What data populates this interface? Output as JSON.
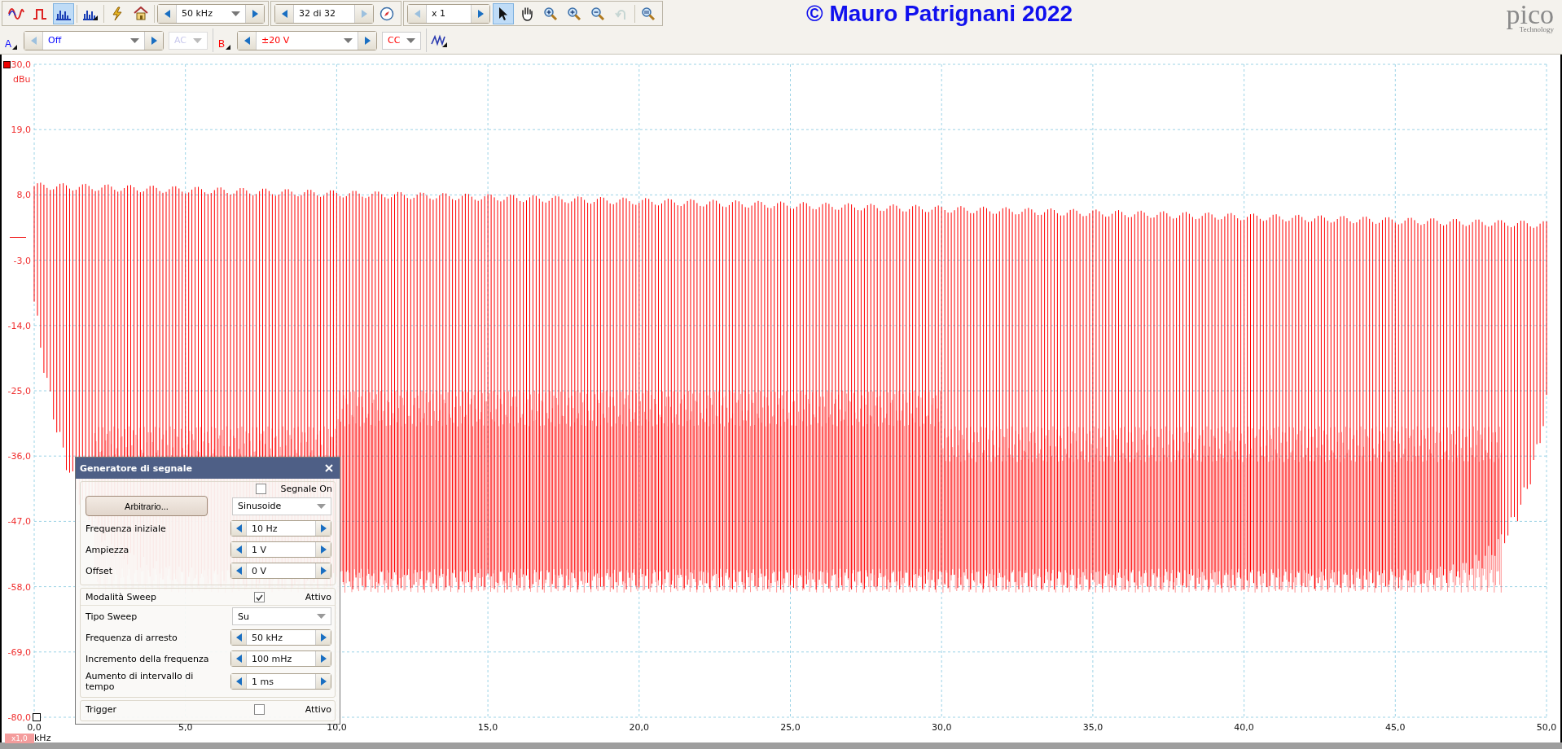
{
  "toolbar": {
    "modes": [
      {
        "kind": "scope",
        "selected": false
      },
      {
        "kind": "persistence",
        "selected": false
      },
      {
        "kind": "spectrum",
        "selected": true
      }
    ],
    "actions": [
      {
        "kind": "spectrum-options"
      },
      {
        "kind": "generator"
      },
      {
        "kind": "home"
      }
    ],
    "timebase": {
      "value": "50 kHz"
    },
    "capture": {
      "value": "32 di 32",
      "next_disabled": true
    },
    "zoom": {
      "value": "x 1",
      "prev_disabled": true
    },
    "tools": [
      {
        "kind": "pointer",
        "selected": true,
        "disabled": false
      },
      {
        "kind": "hand",
        "selected": false,
        "disabled": false
      },
      {
        "kind": "zoom",
        "selected": false,
        "disabled": false
      },
      {
        "kind": "zoom-in",
        "selected": false,
        "disabled": false
      },
      {
        "kind": "zoom-out",
        "selected": false,
        "disabled": false
      },
      {
        "kind": "undo",
        "selected": false,
        "disabled": true
      },
      {
        "kind": "zoom-fit",
        "selected": false,
        "disabled": false
      }
    ],
    "caption": "© Mauro Patrignani 2022",
    "logo": {
      "name": "pico",
      "tagline": "Technology"
    },
    "channels": [
      {
        "label": "A",
        "range": "Off",
        "coupling": "AC",
        "enabled": false,
        "color": "#0000ff"
      },
      {
        "label": "B",
        "range": "±20 V",
        "coupling": "CC",
        "enabled": true,
        "color": "#ff0000"
      }
    ]
  },
  "plot": {
    "y_unit": "dBu",
    "y_ticks": [
      "30,0",
      "19,0",
      "8,0",
      "-3,0",
      "-14,0",
      "-25,0",
      "-36,0",
      "-47,0",
      "-58,0",
      "-69,0",
      "-80,0"
    ],
    "x_unit": "kHz",
    "x_scale": "x1,0",
    "x_ticks": [
      "0,0",
      "5,0",
      "10,0",
      "15,0",
      "20,0",
      "25,0",
      "30,0",
      "35,0",
      "40,0",
      "45,0",
      "50,0"
    ]
  },
  "dialog": {
    "title": "Generatore di segnale",
    "signal_on": {
      "label": "Segnale On",
      "checked": false
    },
    "arbitrary_button": "Arbitrario...",
    "waveform": "Sinusoide",
    "params": [
      {
        "label": "Frequenza iniziale",
        "value": "10 Hz"
      },
      {
        "label": "Ampiezza",
        "value": "1 V"
      },
      {
        "label": "Offset",
        "value": "0 V"
      }
    ],
    "sweep": {
      "title": "Modalità Sweep",
      "checked": true,
      "label": "Attivo",
      "type_label": "Tipo Sweep",
      "type_value": "Su",
      "params": [
        {
          "label": "Frequenza di arresto",
          "value": "50 kHz"
        },
        {
          "label": "Incremento della frequenza",
          "value": "100 mHz"
        },
        {
          "label": "Aumento di intervallo di tempo",
          "value": "1 ms"
        }
      ]
    },
    "trigger": {
      "title": "Trigger",
      "checked": false,
      "label": "Attivo"
    }
  }
}
